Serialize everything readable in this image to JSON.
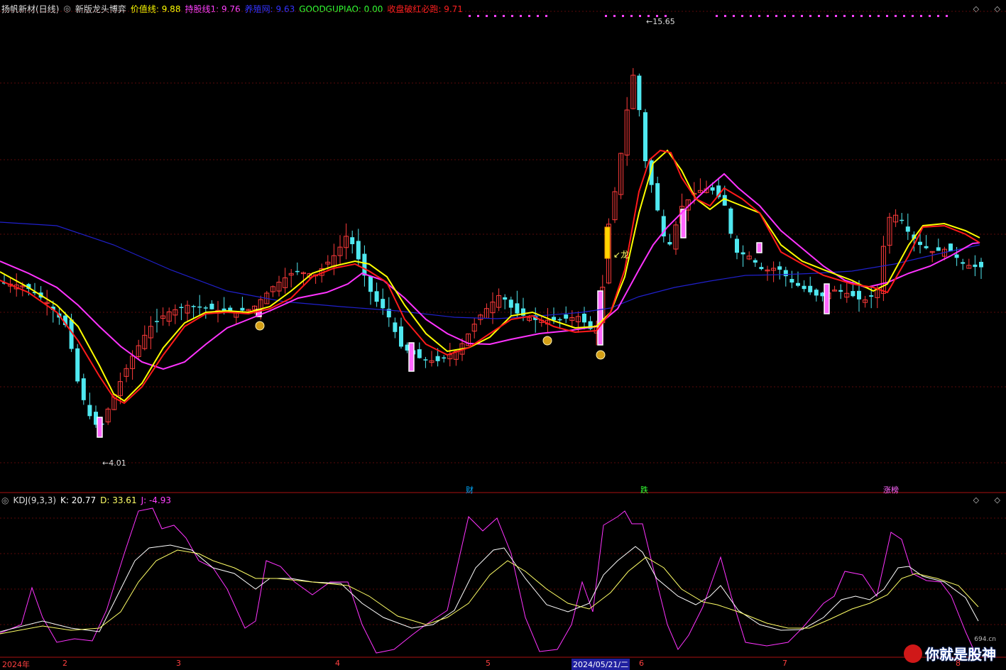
{
  "header": {
    "stock_name": "扬帆新材(日线)",
    "indicator_name": "新版龙头博弈",
    "items": [
      {
        "label": "价值线",
        "value": "9.88",
        "color": "#ffff00"
      },
      {
        "label": "持股线1",
        "value": "9.76",
        "color": "#ff40ff"
      },
      {
        "label": "养殖网",
        "value": "9.63",
        "color": "#3333ff"
      },
      {
        "label": "GOODGUPIAO",
        "value": "0.00",
        "color": "#33ff33"
      },
      {
        "label": "收盘破红必跑",
        "value": "9.71",
        "color": "#ff2020"
      }
    ],
    "icon_buttons": [
      "diamond-left-icon",
      "diamond-right-icon",
      "window-icon",
      "close-icon"
    ]
  },
  "main_chart": {
    "high_marker": "15.65",
    "low_marker": "4.01",
    "dragon_label": "龙",
    "event_labels": [
      {
        "text": "财",
        "color": "#00aaff"
      },
      {
        "text": "跌",
        "color": "#33ff33"
      },
      {
        "text": "涨榜",
        "color": "#ff66ff"
      }
    ]
  },
  "kdj_panel": {
    "title": "KDJ(9,3,3)",
    "k_label": "K: 20.77",
    "d_label": "D: 33.61",
    "j_label": "J: -4.93"
  },
  "time_axis": {
    "labels": [
      "2024年",
      "2",
      "3",
      "4",
      "5",
      "2024/05/21/二",
      "6",
      "7",
      "8"
    ]
  },
  "watermark": {
    "text": "你就是股神",
    "url": "694.cn"
  },
  "chart_data": {
    "type": "candlestick",
    "y_range": [
      4.01,
      15.65
    ],
    "series": [
      {
        "name": "价值线",
        "color": "#ffff00"
      },
      {
        "name": "持股线1",
        "color": "#ff40ff"
      },
      {
        "name": "养殖网",
        "color": "#3333ff"
      },
      {
        "name": "收盘破红必跑",
        "color": "#ff2020"
      }
    ]
  }
}
